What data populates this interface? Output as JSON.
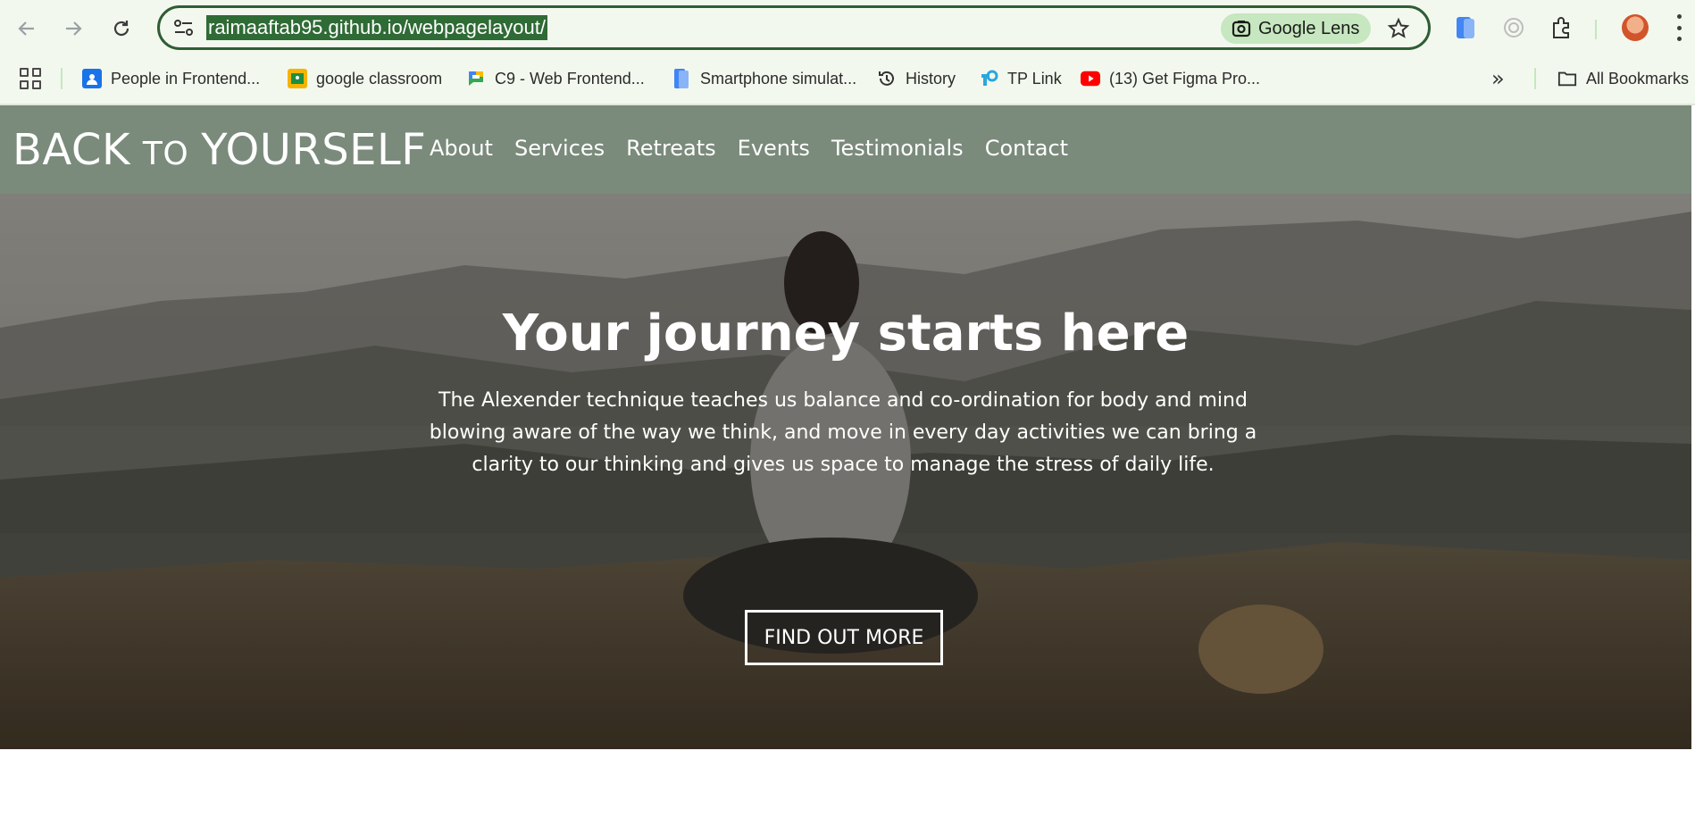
{
  "browser": {
    "url": "raimaaftab95.github.io/webpagelayout/",
    "lens_label": "Google Lens",
    "bookmarks": [
      {
        "label": "People in Frontend...",
        "icon": "contacts-icon",
        "color": "#1a73e8"
      },
      {
        "label": "google classroom",
        "icon": "classroom-icon",
        "color": "#f4b400"
      },
      {
        "label": "C9 - Web Frontend...",
        "icon": "chat-icon",
        "color": "#34a853"
      },
      {
        "label": "Smartphone simulat...",
        "icon": "phone-icon",
        "color": "#4285f4"
      },
      {
        "label": "History",
        "icon": "history-icon",
        "color": "#444444"
      },
      {
        "label": "TP Link",
        "icon": "tplink-icon",
        "color": "#2aa7df"
      },
      {
        "label": "(13) Get Figma Pro...",
        "icon": "youtube-icon",
        "color": "#ff0000"
      }
    ],
    "all_bookmarks_label": "All Bookmarks"
  },
  "site": {
    "logo": {
      "part1": "BACK",
      "part2": "TO",
      "part3": "YOURSELF"
    },
    "nav": [
      "About",
      "Services",
      "Retreats",
      "Events",
      "Testimonials",
      "Contact"
    ],
    "header_color": "#7a8a7b"
  },
  "hero": {
    "title": "Your journey starts here",
    "text": "The Alexender technique teaches us balance and co-ordination for body and mind blowing aware of the way we think, and move in every day activities we can bring a clarity to our thinking and gives us space to manage the stress of daily life.",
    "button_label": "FIND OUT MORE"
  }
}
